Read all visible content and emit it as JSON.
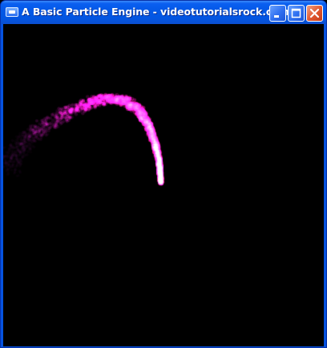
{
  "window": {
    "title": "A Basic Particle Engine - videotutorialsrock.com",
    "icon": "window-app-icon",
    "buttons": [
      {
        "name": "minimize-button",
        "icon": "minimize-icon"
      },
      {
        "name": "maximize-button",
        "icon": "maximize-icon"
      },
      {
        "name": "close-button",
        "icon": "close-icon"
      }
    ]
  },
  "scene": {
    "background": "#000000",
    "particle_color": "#ff1493"
  }
}
